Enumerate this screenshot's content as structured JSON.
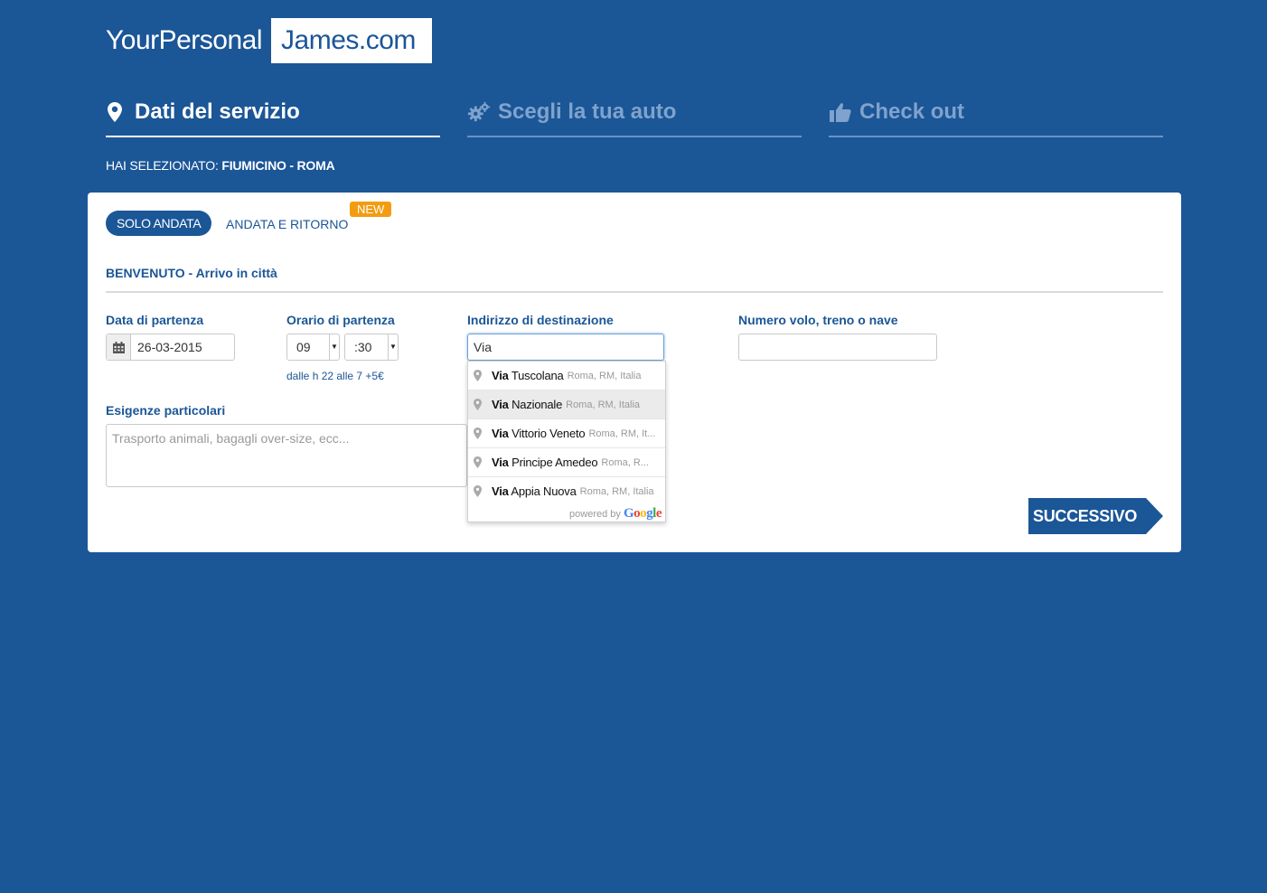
{
  "logo": {
    "part1": "YourPersonal",
    "part2": "James.com"
  },
  "steps": [
    {
      "label": "Dati del servizio",
      "icon": "map-pin-icon",
      "active": true
    },
    {
      "label": "Scegli la tua auto",
      "icon": "gears-icon",
      "active": false
    },
    {
      "label": "Check out",
      "icon": "thumbs-up-icon",
      "active": false
    }
  ],
  "selection": {
    "prefix": "HAI SELEZIONATO:",
    "route": "FIUMICINO - ROMA"
  },
  "trip_type": {
    "one_way": "SOLO ANDATA",
    "round_trip": "ANDATA E RITORNO",
    "new_badge": "NEW"
  },
  "section_title": "BENVENUTO - Arrivo in città",
  "form": {
    "date_label": "Data di partenza",
    "date_value": "26-03-2015",
    "time_label": "Orario di partenza",
    "hour_value": "09",
    "minute_value": ":30",
    "time_hint": "dalle h 22 alle 7 +5€",
    "destination_label": "Indirizzo di destinazione",
    "destination_value": "Via",
    "flight_label": "Numero volo, treno o nave",
    "flight_value": "",
    "notes_label": "Esigenze particolari",
    "notes_placeholder": "Trasporto animali, bagagli over-size, ecc..."
  },
  "autocomplete": {
    "items": [
      {
        "match": "Via",
        "rest": "Tuscolana",
        "secondary": "Roma, RM, Italia"
      },
      {
        "match": "Via",
        "rest": "Nazionale",
        "secondary": "Roma, RM, Italia"
      },
      {
        "match": "Via",
        "rest": "Vittorio Veneto",
        "secondary": "Roma, RM, It..."
      },
      {
        "match": "Via",
        "rest": "Principe Amedeo",
        "secondary": "Roma, R..."
      },
      {
        "match": "Via",
        "rest": "Appia Nuova",
        "secondary": "Roma, RM, Italia"
      }
    ],
    "powered_by": "powered by",
    "google": "Google"
  },
  "next_button": "SUCCESSIVO",
  "colors": {
    "background": "#1b5697",
    "badge": "#f39c12",
    "inactive_step": "#7fa3cc"
  }
}
